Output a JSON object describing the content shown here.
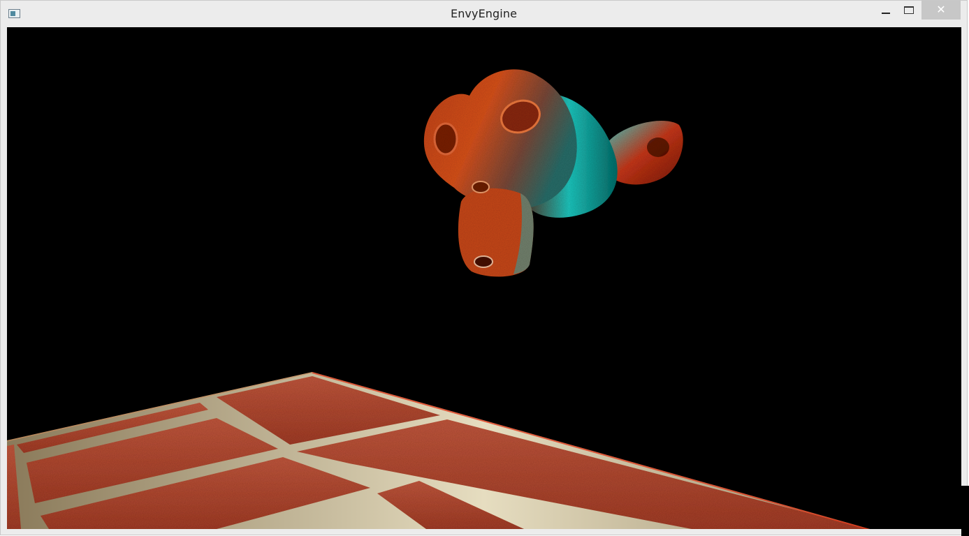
{
  "window": {
    "title": "EnvyEngine",
    "icons": {
      "app": "app-window-icon",
      "minimize": "minimize-icon",
      "maximize": "maximize-icon",
      "close": "close-icon"
    },
    "close_glyph": "✕"
  },
  "viewport": {
    "background_color": "#000000",
    "scene_objects": [
      "monkey-head-model",
      "brick-floor-plane"
    ]
  }
}
